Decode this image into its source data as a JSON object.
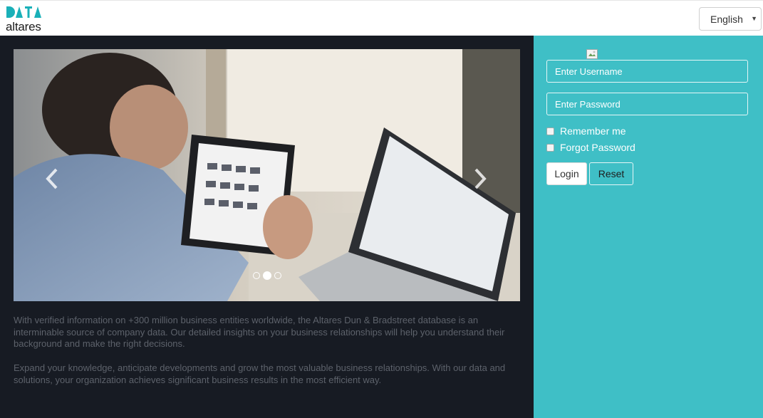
{
  "header": {
    "logo_text": "altares",
    "logo_mark_text": "DATA",
    "language_selected": "English",
    "brand_teal": "#1ab0b8"
  },
  "carousel": {
    "slide_count": 3,
    "active_slide": 2,
    "prev_icon": "chevron-left-icon",
    "next_icon": "chevron-right-icon"
  },
  "description": {
    "paragraph_1": "With verified information on +300 million business entities worldwide, the Altares Dun & Bradstreet database is an interminable source of company data. Our detailed insights on  your business relationships will help you understand their background and make the right decisions.",
    "paragraph_2": "Expand your knowledge, anticipate developments and grow the most valuable business relationships. With our data and solutions, your organization achieves significant business results in the most efficient way."
  },
  "login": {
    "username_placeholder": "Enter Username",
    "password_placeholder": "Enter Password",
    "remember_label": "Remember me",
    "forgot_label": "Forgot Password",
    "login_button": "Login",
    "reset_button": "Reset",
    "panel_color": "#3fbfc6",
    "dark_panel_color": "#171b23"
  }
}
